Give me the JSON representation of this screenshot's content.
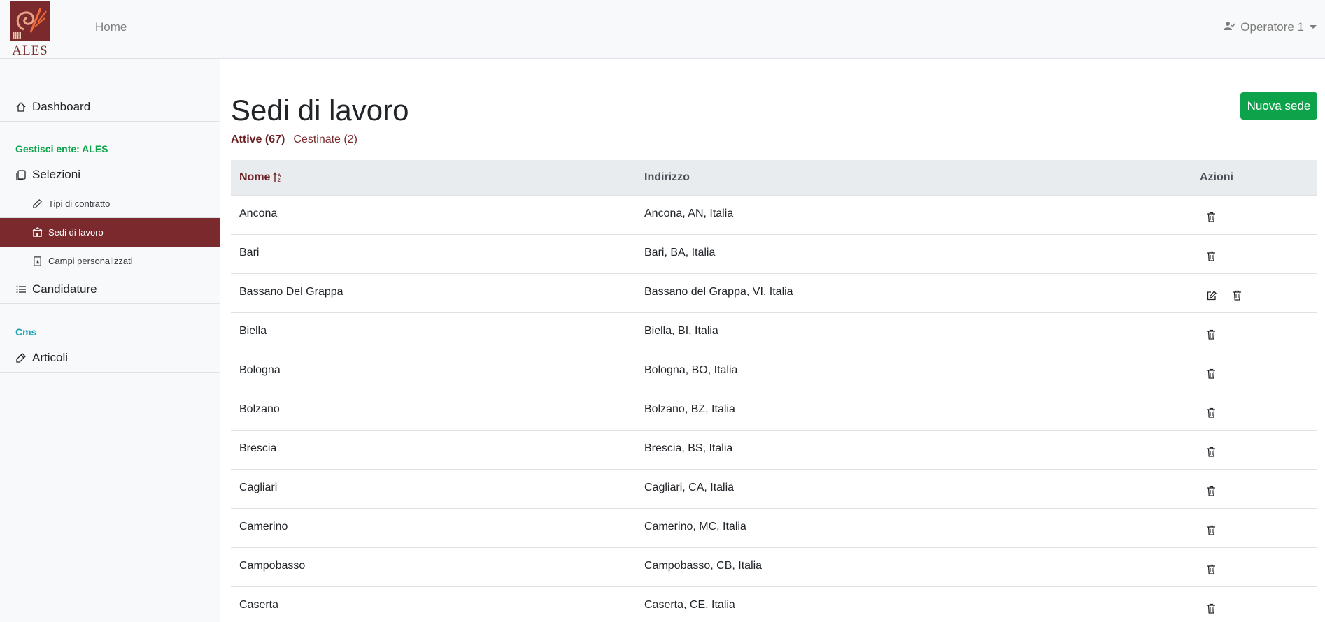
{
  "navbar": {
    "logo_text": "ALES",
    "home_label": "Home",
    "user_label": "Operatore 1"
  },
  "sidebar": {
    "dashboard_label": "Dashboard",
    "section_ente": "Gestisci ente: ALES",
    "selezioni_label": "Selezioni",
    "sub_items": [
      "Tipi di contratto",
      "Sedi di lavoro",
      "Campi personalizzati"
    ],
    "candidature_label": "Candidature",
    "section_cms": "Cms",
    "articoli_label": "Articoli"
  },
  "main": {
    "title": "Sedi di lavoro",
    "new_button": "Nuova sede",
    "filters": {
      "active": "Attive (67)",
      "trashed": "Cestinate (2)"
    },
    "table": {
      "headers": {
        "name": "Nome",
        "address": "Indirizzo",
        "actions": "Azioni"
      },
      "rows": [
        {
          "name": "Ancona",
          "address": "Ancona, AN, Italia",
          "editable": false
        },
        {
          "name": "Bari",
          "address": "Bari, BA, Italia",
          "editable": false
        },
        {
          "name": "Bassano Del Grappa",
          "address": "Bassano del Grappa, VI, Italia",
          "editable": true
        },
        {
          "name": "Biella",
          "address": "Biella, BI, Italia",
          "editable": false
        },
        {
          "name": "Bologna",
          "address": "Bologna, BO, Italia",
          "editable": false
        },
        {
          "name": "Bolzano",
          "address": "Bolzano, BZ, Italia",
          "editable": false
        },
        {
          "name": "Brescia",
          "address": "Brescia, BS, Italia",
          "editable": false
        },
        {
          "name": "Cagliari",
          "address": "Cagliari, CA, Italia",
          "editable": false
        },
        {
          "name": "Camerino",
          "address": "Camerino, MC, Italia",
          "editable": false
        },
        {
          "name": "Campobasso",
          "address": "Campobasso, CB, Italia",
          "editable": false
        },
        {
          "name": "Caserta",
          "address": "Caserta, CE, Italia",
          "editable": false
        }
      ]
    }
  },
  "colors": {
    "brand": "#7a2a2c",
    "section_ente": "#0ca34a",
    "section_cms": "#17a2b8",
    "primary_button": "#0ca34a"
  },
  "icons": {
    "dashboard": "house-icon",
    "selezioni": "copy-icon",
    "tipi": "pencil-icon",
    "sedi": "building-icon",
    "campi": "clipboard-data-icon",
    "candidature": "list-icon",
    "articoli": "pen-icon",
    "user": "user-check-icon",
    "sort": "sort-alpha-icon",
    "edit": "edit-icon",
    "delete": "trash-icon"
  }
}
